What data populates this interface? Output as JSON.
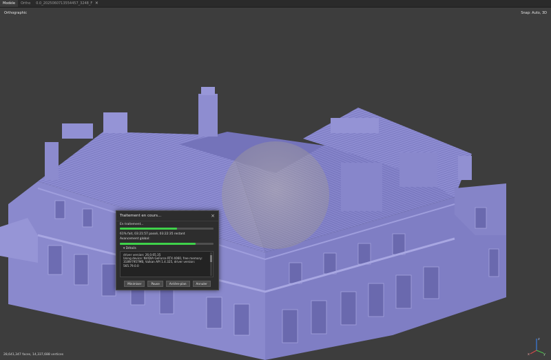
{
  "tabs": [
    {
      "label": "Modèle",
      "active": true
    },
    {
      "label": "Ortho"
    },
    {
      "label": "0.0_2025060713554457_3248_F"
    }
  ],
  "tab_close_icon": "×",
  "viewport": {
    "view_mode": "Orthographic",
    "snap": "Snap: Auto, 3D",
    "stats": "28,641,347 faces, 14,337,688 vertices",
    "mesh_color": "#8c8bd0",
    "background_color": "#3d3d3d",
    "axis": {
      "x": "x",
      "y": "y",
      "z": "z"
    }
  },
  "dialog": {
    "title": "Traitement en cours...",
    "close_icon": "×",
    "status_label": "En traitement...",
    "task_progress": 0.61,
    "task_text": "61% fait, 03:21:57 passé, 03:22:35 restant",
    "global_label": "Avancement global:",
    "global_progress": 0.81,
    "details_label": "▾ Détails",
    "log": "driver version: 26.0.65.35\nUsing device: NVIDIA GeForce RTX 4060, free memory: 3189/7957MB, Vulkan API 1.4.325, driver version: 565.79.0.0",
    "buttons": {
      "minimize": "Minimiser",
      "pause": "Pause",
      "background": "Arrière-plan",
      "cancel": "Annuler"
    },
    "accent_color": "#3fd24a"
  }
}
